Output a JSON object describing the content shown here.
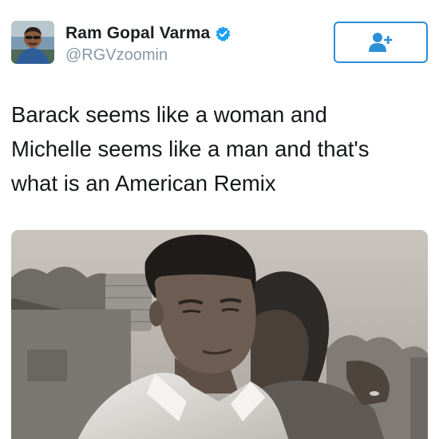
{
  "user": {
    "display_name": "Ram Gopal Varma",
    "handle": "@RGVzoomin",
    "verified": true,
    "avatar_icon": "user-avatar-icon"
  },
  "follow_button": {
    "icon": "add-user-icon",
    "accent_color": "#2b8fd6"
  },
  "tweet": {
    "lines": [
      "Barack seems like a woman and",
      "Michelle seems like a man and that's",
      "what is an American Remix"
    ]
  },
  "media": {
    "kind": "photo",
    "style": "black-and-white"
  },
  "colors": {
    "name_text": "#1b1f23",
    "handle_text": "#8899a6",
    "verified_badge": "#1da1f2"
  }
}
